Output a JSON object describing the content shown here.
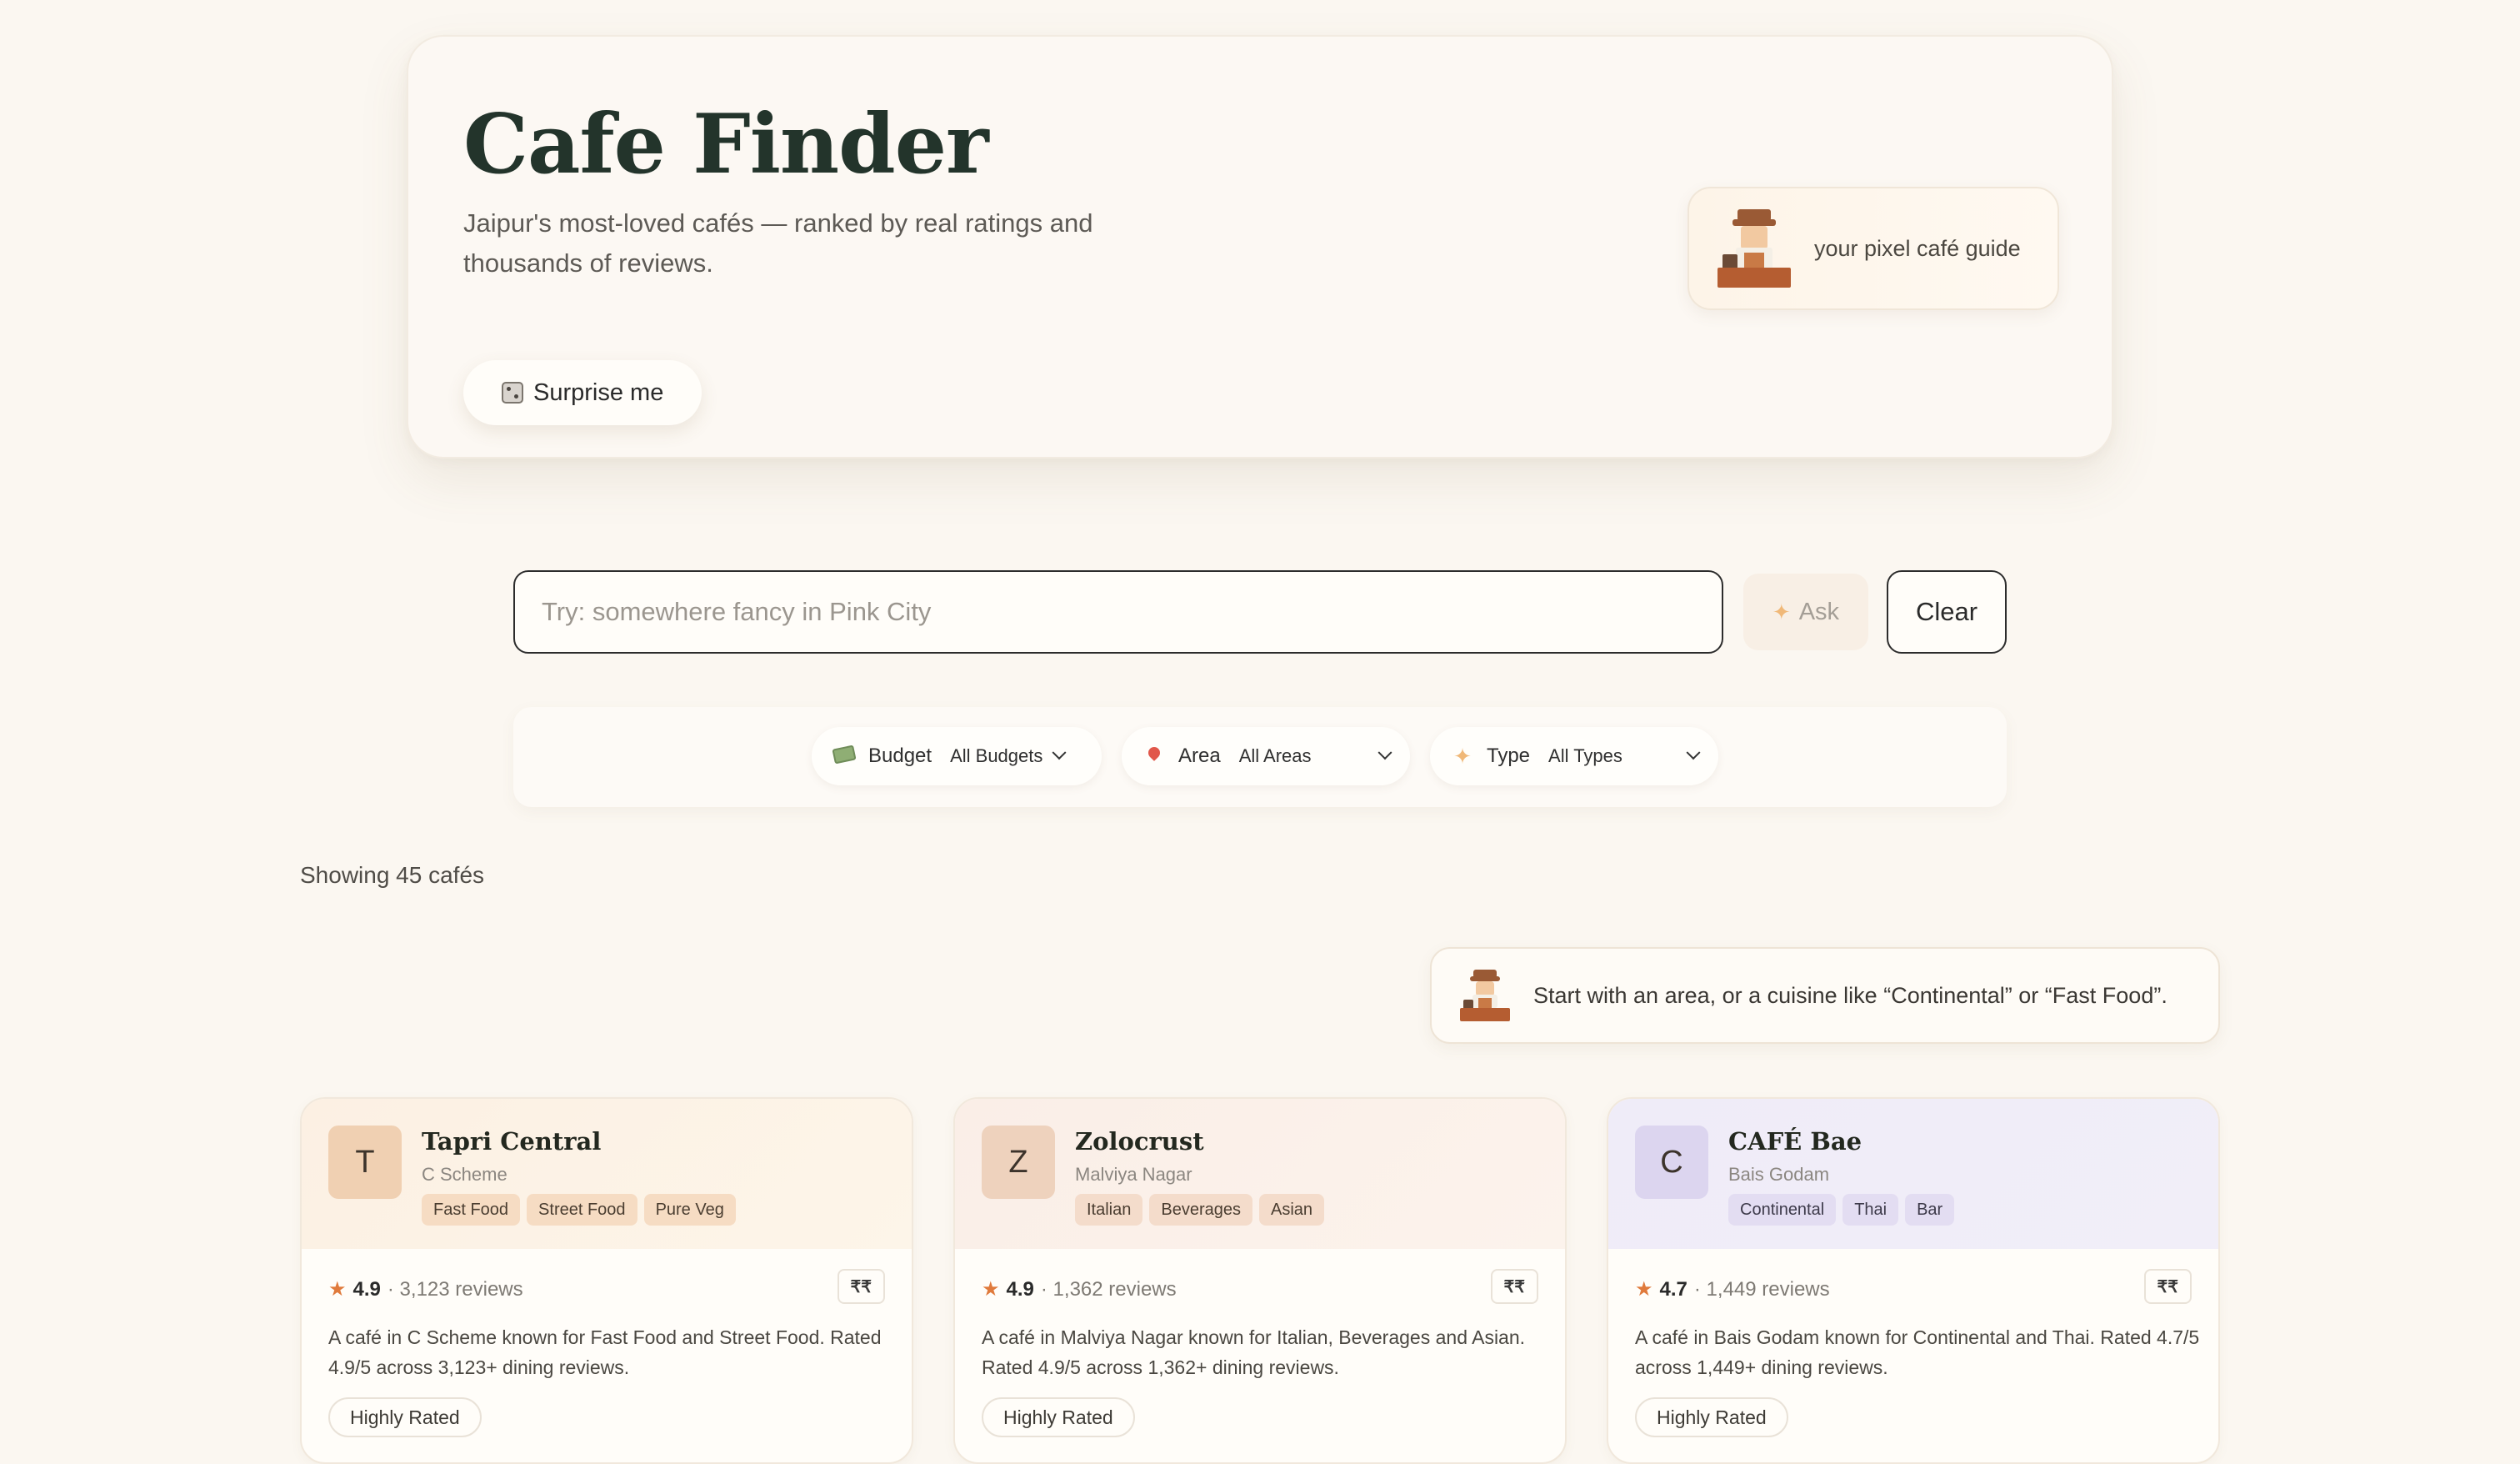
{
  "hero": {
    "title": "Cafe Finder",
    "subtitle": "Jaipur's most-loved cafés — ranked by real ratings and thousands of reviews.",
    "surprise_label": "Surprise me",
    "surprise_icon": "dice-icon",
    "guide_label": "your pixel café guide",
    "guide_icon": "barista-mascot-icon"
  },
  "search": {
    "placeholder": "Try: somewhere fancy in Pink City",
    "value": "",
    "ask_label": "Ask",
    "clear_label": "Clear"
  },
  "filters": [
    {
      "icon": "money-icon",
      "label": "Budget",
      "value": "All Budgets"
    },
    {
      "icon": "pin-icon",
      "label": "Area",
      "value": "All Areas"
    },
    {
      "icon": "sparkle-icon",
      "label": "Type",
      "value": "All Types"
    }
  ],
  "results": {
    "showing": "Showing 45 cafés",
    "tip": "Start with an area, or a cuisine like “Continental” or “Fast Food”."
  },
  "cafes": [
    {
      "initial": "T",
      "name": "Tapri Central",
      "area": "C Scheme",
      "tags": [
        "Fast Food",
        "Street Food",
        "Pure Veg"
      ],
      "rating": "4.9",
      "reviews": "· 3,123 reviews",
      "price": "₹₹",
      "description": "A café in C Scheme known for Fast Food and Street Food. Rated 4.9/5 across 3,123+ dining reviews.",
      "badge": "Highly Rated"
    },
    {
      "initial": "Z",
      "name": "Zolocrust",
      "area": "Malviya Nagar",
      "tags": [
        "Italian",
        "Beverages",
        "Asian"
      ],
      "rating": "4.9",
      "reviews": "· 1,362 reviews",
      "price": "₹₹",
      "description": "A café in Malviya Nagar known for Italian, Beverages and Asian. Rated 4.9/5 across 1,362+ dining reviews.",
      "badge": "Highly Rated"
    },
    {
      "initial": "C",
      "name": "CAFÉ Bae",
      "area": "Bais Godam",
      "tags": [
        "Continental",
        "Thai",
        "Bar"
      ],
      "rating": "4.7",
      "reviews": "· 1,449 reviews",
      "price": "₹₹",
      "description": "A café in Bais Godam known for Continental and Thai. Rated 4.7/5 across 1,449+ dining reviews.",
      "badge": "Highly Rated"
    }
  ],
  "colors": {
    "page_bg": "#fbf7f1",
    "title": "#23342b",
    "star": "#e07a3c",
    "accent_sparkle": "#f0b878"
  }
}
